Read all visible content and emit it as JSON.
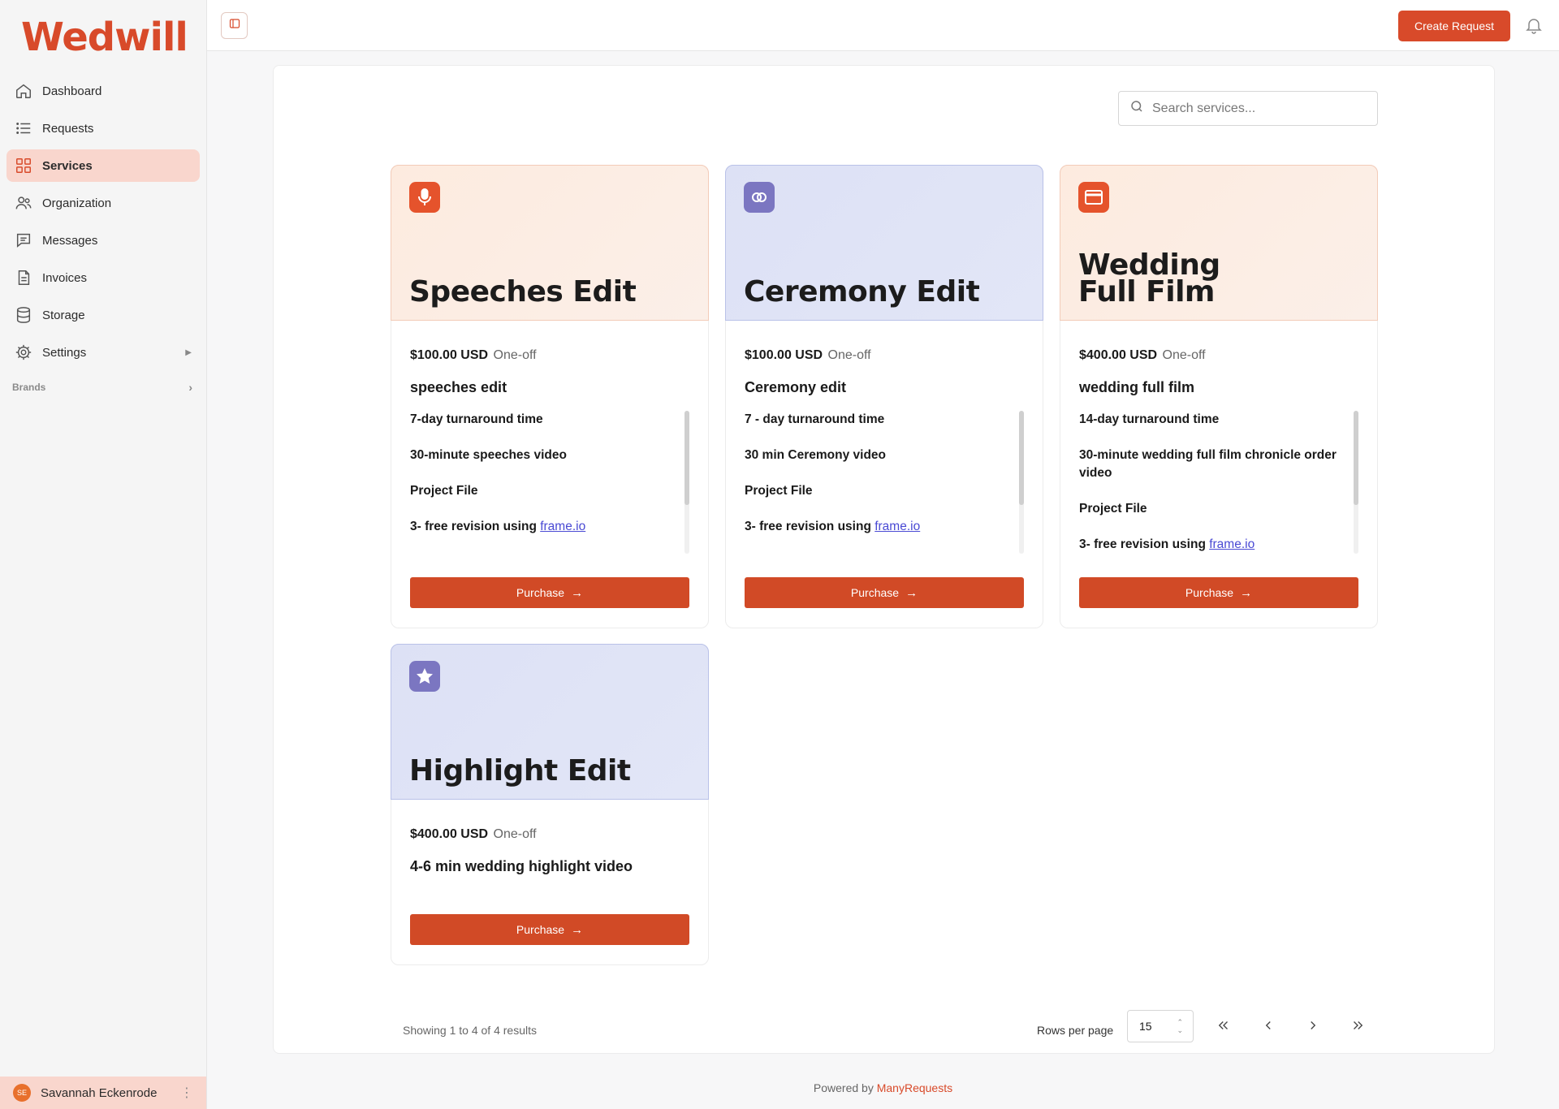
{
  "app": {
    "logo": "Wedwill",
    "accent_color": "#d84a2a"
  },
  "sidebar": {
    "items": [
      {
        "label": "Dashboard",
        "icon": "home-icon"
      },
      {
        "label": "Requests",
        "icon": "list-icon"
      },
      {
        "label": "Services",
        "icon": "grid-icon",
        "active": true
      },
      {
        "label": "Organization",
        "icon": "users-icon"
      },
      {
        "label": "Messages",
        "icon": "message-icon"
      },
      {
        "label": "Invoices",
        "icon": "file-icon"
      },
      {
        "label": "Storage",
        "icon": "database-icon"
      },
      {
        "label": "Settings",
        "icon": "gear-icon"
      }
    ],
    "brands_label": "Brands",
    "user": {
      "initials": "SE",
      "name": "Savannah Eckenrode"
    }
  },
  "topbar": {
    "create_label": "Create Request"
  },
  "search": {
    "placeholder": "Search services..."
  },
  "services": [
    {
      "title": "Speeches Edit",
      "price": "$100.00 USD",
      "frequency": "One-off",
      "name": "speeches edit",
      "features": [
        "7-day turnaround time",
        "30-minute speeches video",
        "Project File",
        "3- free revision using "
      ],
      "link": "frame.io",
      "purchase_label": "Purchase"
    },
    {
      "title": "Ceremony Edit",
      "price": "$100.00 USD",
      "frequency": "One-off",
      "name": "Ceremony edit",
      "features": [
        "7 - day turnaround time",
        "30 min Ceremony video",
        "Project File",
        "3- free revision using "
      ],
      "link": "frame.io",
      "purchase_label": "Purchase"
    },
    {
      "title": "Wedding\nFull Film",
      "price": "$400.00 USD",
      "frequency": "One-off",
      "name": "wedding full film",
      "features": [
        "14-day turnaround time",
        "30-minute wedding full film chronicle order video",
        "Project File",
        "3- free revision using "
      ],
      "link": "frame.io",
      "purchase_label": "Purchase"
    },
    {
      "title": "Highlight Edit",
      "price": "$400.00 USD",
      "frequency": "One-off",
      "name": "4-6 min wedding highlight video",
      "purchase_label": "Purchase"
    }
  ],
  "pagination": {
    "showing": "Showing 1 to 4 of 4 results",
    "rows_label": "Rows per page",
    "rows_value": "15"
  },
  "footer": {
    "powered_prefix": "Powered by ",
    "powered_brand": "ManyRequests"
  }
}
